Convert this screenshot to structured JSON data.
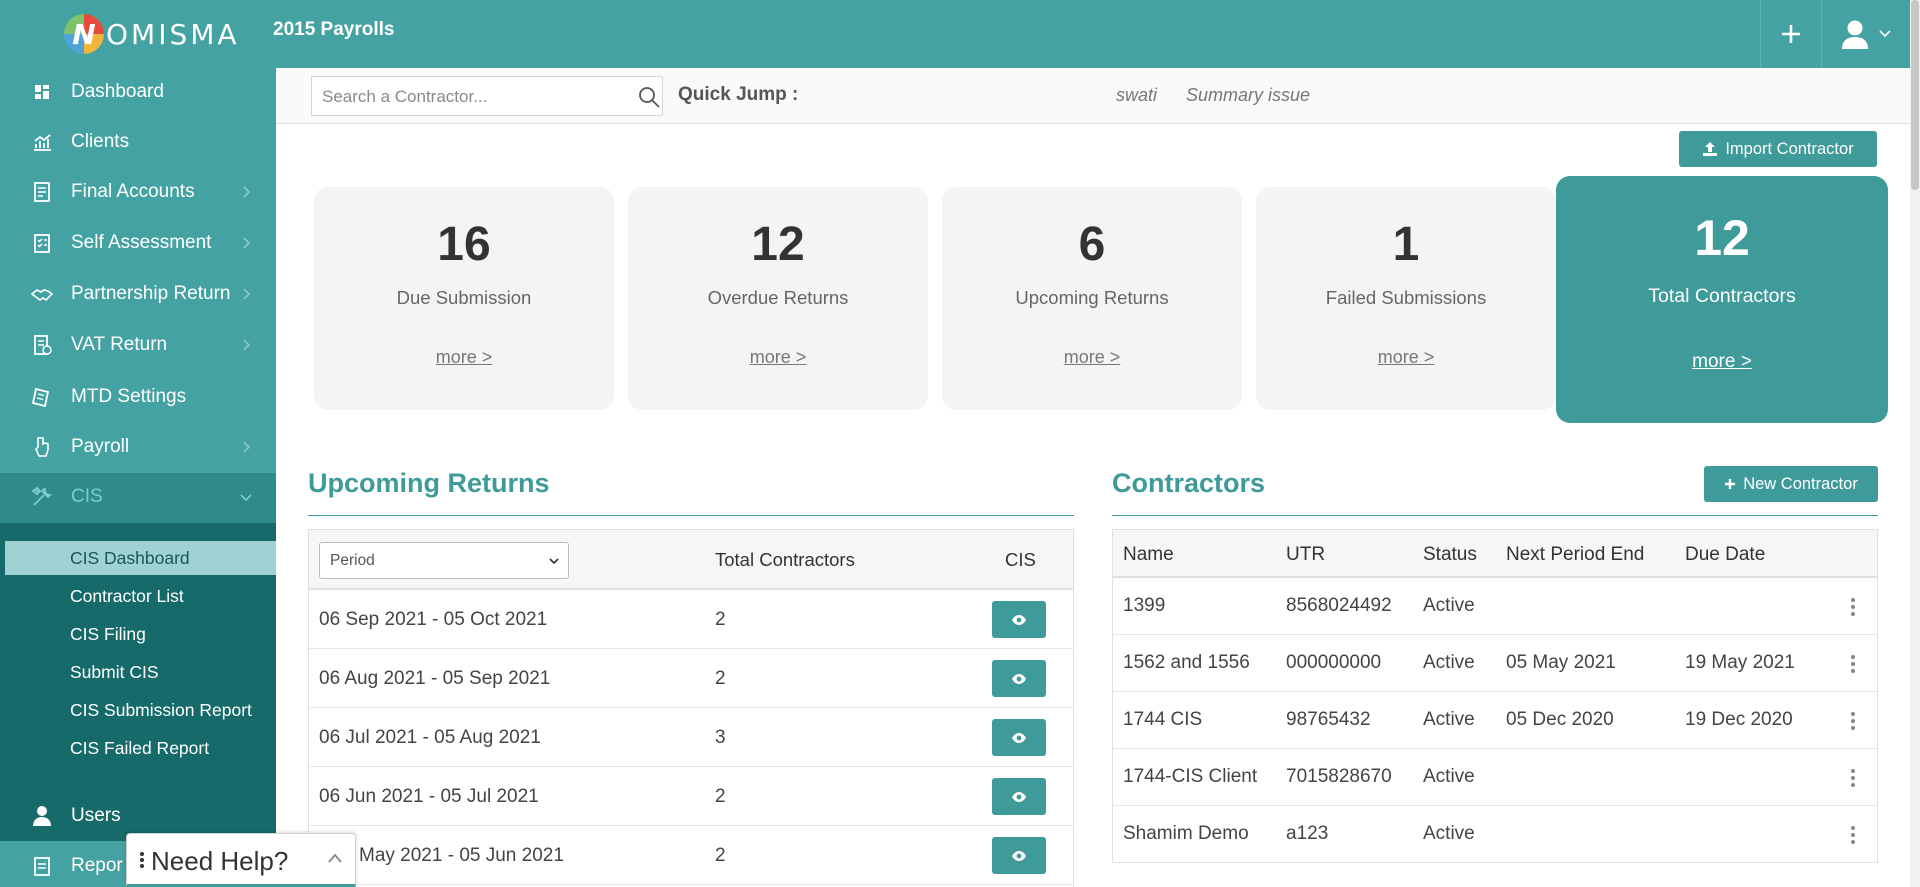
{
  "header": {
    "logo_letter": "N",
    "logo_text": "OMISMA",
    "title": "2015 Payrolls",
    "add_icon": "plus-icon",
    "user_icon": "user-icon"
  },
  "sidebar": {
    "items": [
      {
        "label": "Dashboard",
        "icon": "dashboard-icon"
      },
      {
        "label": "Clients",
        "icon": "chart-icon"
      },
      {
        "label": "Final Accounts",
        "icon": "accounts-icon"
      },
      {
        "label": "Self Assessment",
        "icon": "clipboard-icon"
      },
      {
        "label": "Partnership Return",
        "icon": "handshake-icon"
      },
      {
        "label": "VAT Return",
        "icon": "vat-icon"
      },
      {
        "label": "MTD Settings",
        "icon": "settings-doc-icon"
      },
      {
        "label": "Payroll",
        "icon": "payroll-icon"
      },
      {
        "label": "CIS",
        "icon": "tools-icon"
      }
    ],
    "cis_submenu": [
      "CIS Dashboard",
      "Contractor List",
      "CIS Filing",
      "Submit CIS",
      "CIS Submission Report",
      "CIS Failed Report"
    ],
    "bottom_items": [
      {
        "label": "Users",
        "icon": "user-icon"
      },
      {
        "label": "Repor",
        "icon": "reports-icon"
      }
    ]
  },
  "search": {
    "placeholder": "Search a Contractor...",
    "value": "",
    "quick_jump_label": "Quick Jump :",
    "quick_links": [
      "swati",
      "Summary issue"
    ]
  },
  "import_button": "Import Contractor",
  "stats": [
    {
      "value": "16",
      "label": "Due Submission",
      "link": "more >"
    },
    {
      "value": "12",
      "label": "Overdue Returns",
      "link": "more >"
    },
    {
      "value": "6",
      "label": "Upcoming Returns",
      "link": "more >"
    },
    {
      "value": "1",
      "label": "Failed Submissions",
      "link": "more >"
    },
    {
      "value": "12",
      "label": "Total Contractors",
      "link": "more >"
    }
  ],
  "upcoming": {
    "title": "Upcoming Returns",
    "select_value": "Period",
    "columns": [
      "Total Contractors",
      "CIS"
    ],
    "rows": [
      {
        "period": "06 Sep 2021 - 05 Oct 2021",
        "total": "2"
      },
      {
        "period": "06 Aug 2021 - 05 Sep 2021",
        "total": "2"
      },
      {
        "period": "06 Jul 2021 - 05 Aug 2021",
        "total": "3"
      },
      {
        "period": "06 Jun 2021 - 05 Jul 2021",
        "total": "2"
      },
      {
        "period": "May 2021 - 05 Jun 2021",
        "total": "2"
      }
    ]
  },
  "contractors": {
    "title": "Contractors",
    "new_button": "New Contractor",
    "columns": [
      "Name",
      "UTR",
      "Status",
      "Next Period End",
      "Due Date"
    ],
    "rows": [
      {
        "name": "1399",
        "utr": "8568024492",
        "status": "Active",
        "next": "",
        "due": ""
      },
      {
        "name": "1562 and 1556",
        "utr": "000000000",
        "status": "Active",
        "next": "05 May 2021",
        "due": "19 May 2021"
      },
      {
        "name": "1744 CIS",
        "utr": "98765432",
        "status": "Active",
        "next": "05 Dec 2020",
        "due": "19 Dec 2020"
      },
      {
        "name": "1744-CIS Client",
        "utr": "7015828670",
        "status": "Active",
        "next": "",
        "due": ""
      },
      {
        "name": "Shamim Demo",
        "utr": "a123",
        "status": "Active",
        "next": "",
        "due": ""
      }
    ]
  },
  "help": {
    "label": "Need Help?"
  },
  "colors": {
    "primary": "#45a2a2",
    "accent": "#3f9a9a",
    "submenu": "#166a6a",
    "active_sub": "#9fd3d3"
  }
}
